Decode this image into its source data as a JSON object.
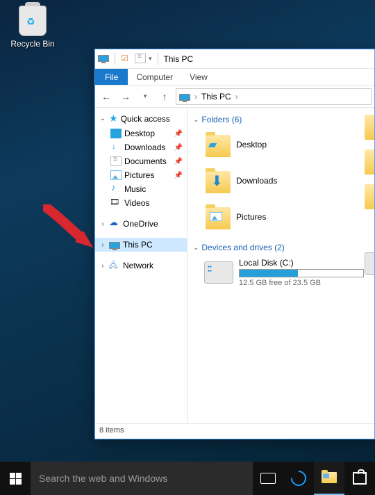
{
  "desktop": {
    "recycle_bin": "Recycle Bin"
  },
  "arrow": {
    "color": "#d8272f"
  },
  "window": {
    "title": "This PC",
    "file_tab": "File",
    "tabs": [
      "Computer",
      "View"
    ],
    "address": {
      "location": "This PC"
    },
    "nav": {
      "quick_access": "Quick access",
      "items": [
        {
          "label": "Desktop"
        },
        {
          "label": "Downloads"
        },
        {
          "label": "Documents"
        },
        {
          "label": "Pictures"
        },
        {
          "label": "Music"
        },
        {
          "label": "Videos"
        }
      ],
      "onedrive": "OneDrive",
      "this_pc": "This PC",
      "network": "Network"
    },
    "content": {
      "folders_header": "Folders (6)",
      "folders": [
        {
          "label": "Desktop"
        },
        {
          "label": "Downloads"
        },
        {
          "label": "Pictures"
        }
      ],
      "devices_header": "Devices and drives (2)",
      "drive": {
        "name": "Local Disk (C:)",
        "free_text": "12.5 GB free of 23.5 GB",
        "used_percent": 47
      }
    },
    "status": "8 items"
  },
  "taskbar": {
    "search_placeholder": "Search the web and Windows"
  }
}
